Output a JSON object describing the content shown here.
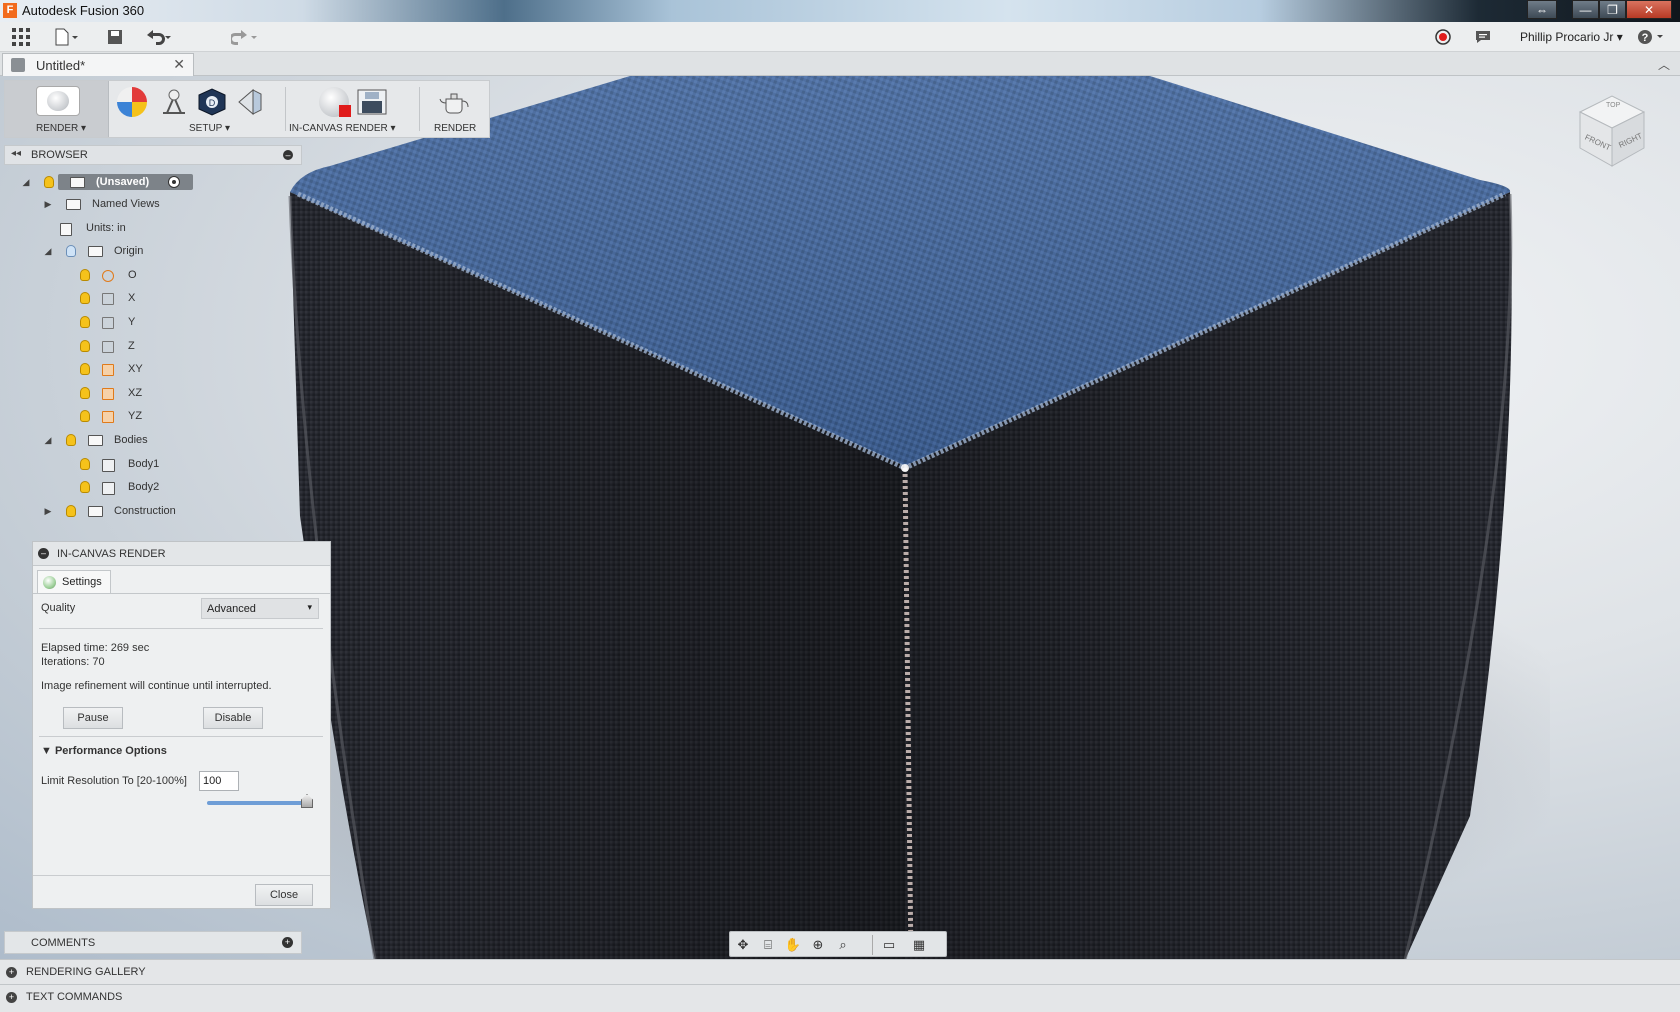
{
  "window": {
    "app_title": "Autodesk Fusion 360",
    "logo_letter": "F",
    "controls": {
      "restore_glyph": "⇔",
      "minimize_glyph": "—",
      "maximize_glyph": "❐",
      "close_glyph": "✕"
    }
  },
  "app_toolbar": {
    "user_name": "Phillip Procario Jr",
    "icons": [
      "apps-grid-icon",
      "file-icon",
      "save-icon",
      "undo-icon",
      "redo-icon",
      "record-icon",
      "comment-icon",
      "help-icon"
    ]
  },
  "document_tab": {
    "title": "Untitled*",
    "close_glyph": "✕"
  },
  "ribbon": {
    "render_label": "RENDER",
    "setup_label": "SETUP",
    "in_canvas_label": "IN-CANVAS RENDER",
    "render2_label": "RENDER",
    "dropdown_caret": "▾"
  },
  "browser": {
    "title": "BROWSER",
    "root_label": "(Unsaved)",
    "items": [
      {
        "label": "Named Views"
      },
      {
        "label": "Units: in"
      },
      {
        "label": "Origin"
      },
      {
        "label": "O"
      },
      {
        "label": "X"
      },
      {
        "label": "Y"
      },
      {
        "label": "Z"
      },
      {
        "label": "XY"
      },
      {
        "label": "XZ"
      },
      {
        "label": "YZ"
      },
      {
        "label": "Bodies"
      },
      {
        "label": "Body1"
      },
      {
        "label": "Body2"
      },
      {
        "label": "Construction"
      }
    ]
  },
  "in_canvas_render": {
    "title": "IN-CANVAS RENDER",
    "tab_settings": "Settings",
    "quality_label": "Quality",
    "quality_value": "Advanced",
    "elapsed": "Elapsed time: 269 sec",
    "iterations": "Iterations: 70",
    "refinement_note": "Image refinement will continue until interrupted.",
    "pause_label": "Pause",
    "disable_label": "Disable",
    "performance_title": "Performance Options",
    "limit_label": "Limit Resolution To [20-100%]",
    "limit_value": "100",
    "limit_slider_fraction": 1.0,
    "close_label": "Close"
  },
  "viewcube": {
    "top": "TOP",
    "front": "FRONT",
    "right": "RIGHT"
  },
  "panels": {
    "comments": "COMMENTS",
    "rendering_gallery": "RENDERING GALLERY",
    "text_commands": "TEXT COMMANDS"
  },
  "colors": {
    "accent_blue": "#6e9dd6",
    "top_face": "#3f5f93",
    "side_face": "#24262d",
    "bulb": "#f5c21b"
  }
}
